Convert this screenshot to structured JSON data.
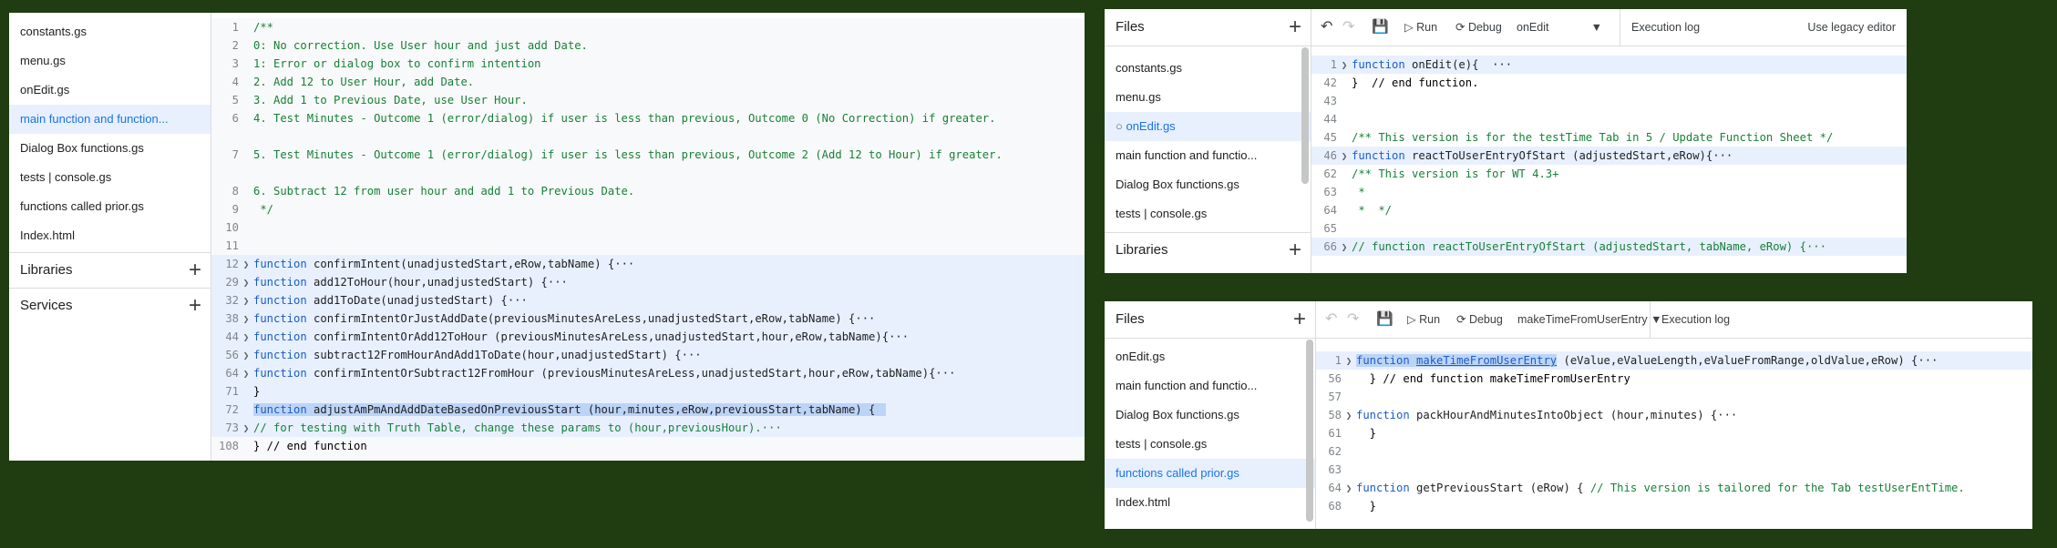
{
  "left_panel": {
    "files": [
      "constants.gs",
      "menu.gs",
      "onEdit.gs",
      "main function and function...",
      "Dialog Box functions.gs",
      "tests | console.gs",
      "functions called prior.gs",
      "Index.html"
    ],
    "active_file_index": 3,
    "libraries_label": "Libraries",
    "services_label": "Services",
    "code_lines": [
      {
        "n": "1",
        "t": "/**",
        "c": "cm"
      },
      {
        "n": "2",
        "t": "0: No correction. Use User hour and just add Date.",
        "c": "cm"
      },
      {
        "n": "3",
        "t": "1: Error or dialog box to confirm intention",
        "c": "cm"
      },
      {
        "n": "4",
        "t": "2. Add 12 to User Hour, add Date.",
        "c": "cm"
      },
      {
        "n": "5",
        "t": "3. Add 1 to Previous Date, use User Hour.",
        "c": "cm"
      },
      {
        "n": "6",
        "t": "4. Test Minutes - Outcome 1 (error/dialog) if user is less than previous, Outcome 0 (No Correction) if greater.",
        "c": "cm"
      },
      {
        "n": "",
        "t": "",
        "c": "cm"
      },
      {
        "n": "7",
        "t": "5. Test Minutes - Outcome 1 (error/dialog) if user is less than previous, Outcome 2 (Add 12 to Hour) if greater.",
        "c": "cm"
      },
      {
        "n": "",
        "t": "",
        "c": "cm"
      },
      {
        "n": "8",
        "t": "6. Subtract 12 from user hour and add 1 to Previous Date.",
        "c": "cm"
      },
      {
        "n": "9",
        "t": " */",
        "c": "cm"
      },
      {
        "n": "10",
        "t": "",
        "c": "cm"
      },
      {
        "n": "11",
        "t": "",
        "c": "cm"
      },
      {
        "n": "12",
        "t": "confirmIntent(unadjustedStart,eRow,tabName) {···",
        "c": "fnline",
        "fold": true
      },
      {
        "n": "29",
        "t": "add12ToHour(hour,unadjustedStart) {···",
        "c": "fnline",
        "fold": true
      },
      {
        "n": "32",
        "t": "add1ToDate(unadjustedStart) {···",
        "c": "fnline",
        "fold": true
      },
      {
        "n": "38",
        "t": "confirmIntentOrJustAddDate(previousMinutesAreLess,unadjustedStart,eRow,tabName) {···",
        "c": "fnline",
        "fold": true
      },
      {
        "n": "44",
        "t": "confirmIntentOrAdd12ToHour (previousMinutesAreLess,unadjustedStart,hour,eRow,tabName){···",
        "c": "fnline",
        "fold": true
      },
      {
        "n": "56",
        "t": "subtract12FromHourAndAdd1ToDate(hour,unadjustedStart) {···",
        "c": "fnline",
        "fold": true
      },
      {
        "n": "64",
        "t": "confirmIntentOrSubtract12FromHour (previousMinutesAreLess,unadjustedStart,hour,eRow,tabName){···",
        "c": "fnline",
        "fold": true
      },
      {
        "n": "71",
        "t": "}",
        "c": "plainhl"
      },
      {
        "n": "72",
        "t": "adjustAmPmAndAddDateBasedOnPreviousStart (hour,minutes,eRow,previousStart,tabName) {",
        "c": "fnsel"
      },
      {
        "n": "73",
        "t": "// for testing with Truth Table, change these params to (hour,previousHour).···",
        "c": "cmhl",
        "fold": true
      },
      {
        "n": "108",
        "t": "} // end function",
        "c": "plainend"
      }
    ]
  },
  "top_right_panel": {
    "files_label": "Files",
    "toolbar": {
      "run": "Run",
      "debug": "Debug",
      "function_select": "onEdit",
      "execution_log": "Execution log",
      "legacy": "Use legacy editor"
    },
    "files": [
      "constants.gs",
      "menu.gs",
      "onEdit.gs",
      "main function and functio...",
      "Dialog Box functions.gs",
      "tests | console.gs"
    ],
    "active_file_index": 2,
    "libraries_label": "Libraries",
    "code_lines": [
      {
        "n": "1",
        "fold": true,
        "kw": "function",
        "t": " onEdit(e){  ···",
        "hl": true
      },
      {
        "n": "42",
        "t": "}  // end function.",
        "c": "plain"
      },
      {
        "n": "43",
        "t": ""
      },
      {
        "n": "44",
        "t": ""
      },
      {
        "n": "45",
        "t": "/** This version is for the testTime Tab in 5 / Update Function Sheet */",
        "c": "cm"
      },
      {
        "n": "46",
        "fold": true,
        "kw": "function",
        "t": " reactToUserEntryOfStart (adjustedStart,eRow){···",
        "hl": true
      },
      {
        "n": "62",
        "t": "/** This version is for WT 4.3+",
        "c": "cm"
      },
      {
        "n": "63",
        "t": " *",
        "c": "cm"
      },
      {
        "n": "64",
        "t": " *  */",
        "c": "cm"
      },
      {
        "n": "65",
        "t": ""
      },
      {
        "n": "66",
        "fold": true,
        "t": "// function reactToUserEntryOfStart (adjustedStart, tabName, eRow) {···",
        "c": "cm",
        "hl": true
      }
    ]
  },
  "bottom_right_panel": {
    "files_label": "Files",
    "toolbar": {
      "run": "Run",
      "debug": "Debug",
      "function_select": "makeTimeFromUserEntry",
      "execution_log": "Execution log"
    },
    "files": [
      "onEdit.gs",
      "main function and functio...",
      "Dialog Box functions.gs",
      "tests | console.gs",
      "functions called prior.gs",
      "Index.html"
    ],
    "active_file_index": 4,
    "code_lines": [
      {
        "n": "1",
        "fold": true,
        "kwsel": "function",
        "namesel": "makeTimeFromUserEntry",
        "t": " (eValue,eValueLength,eValueFromRange,oldValue,eRow) {···",
        "hl": true
      },
      {
        "n": "56",
        "t": "  } // end function makeTimeFromUserEntry",
        "c": "plain"
      },
      {
        "n": "57",
        "t": ""
      },
      {
        "n": "58",
        "fold": true,
        "kw": "function",
        "t": " packHourAndMinutesIntoObject (hour,minutes) {···"
      },
      {
        "n": "61",
        "t": "  }",
        "c": "plain"
      },
      {
        "n": "62",
        "t": ""
      },
      {
        "n": "63",
        "t": ""
      },
      {
        "n": "64",
        "fold": true,
        "kw": "function",
        "t": " getPreviousStart (eRow) {",
        "cm": " // This version is tailored for the Tab testUserEntTime."
      },
      {
        "n": "68",
        "t": "  }",
        "c": "plain"
      }
    ]
  }
}
